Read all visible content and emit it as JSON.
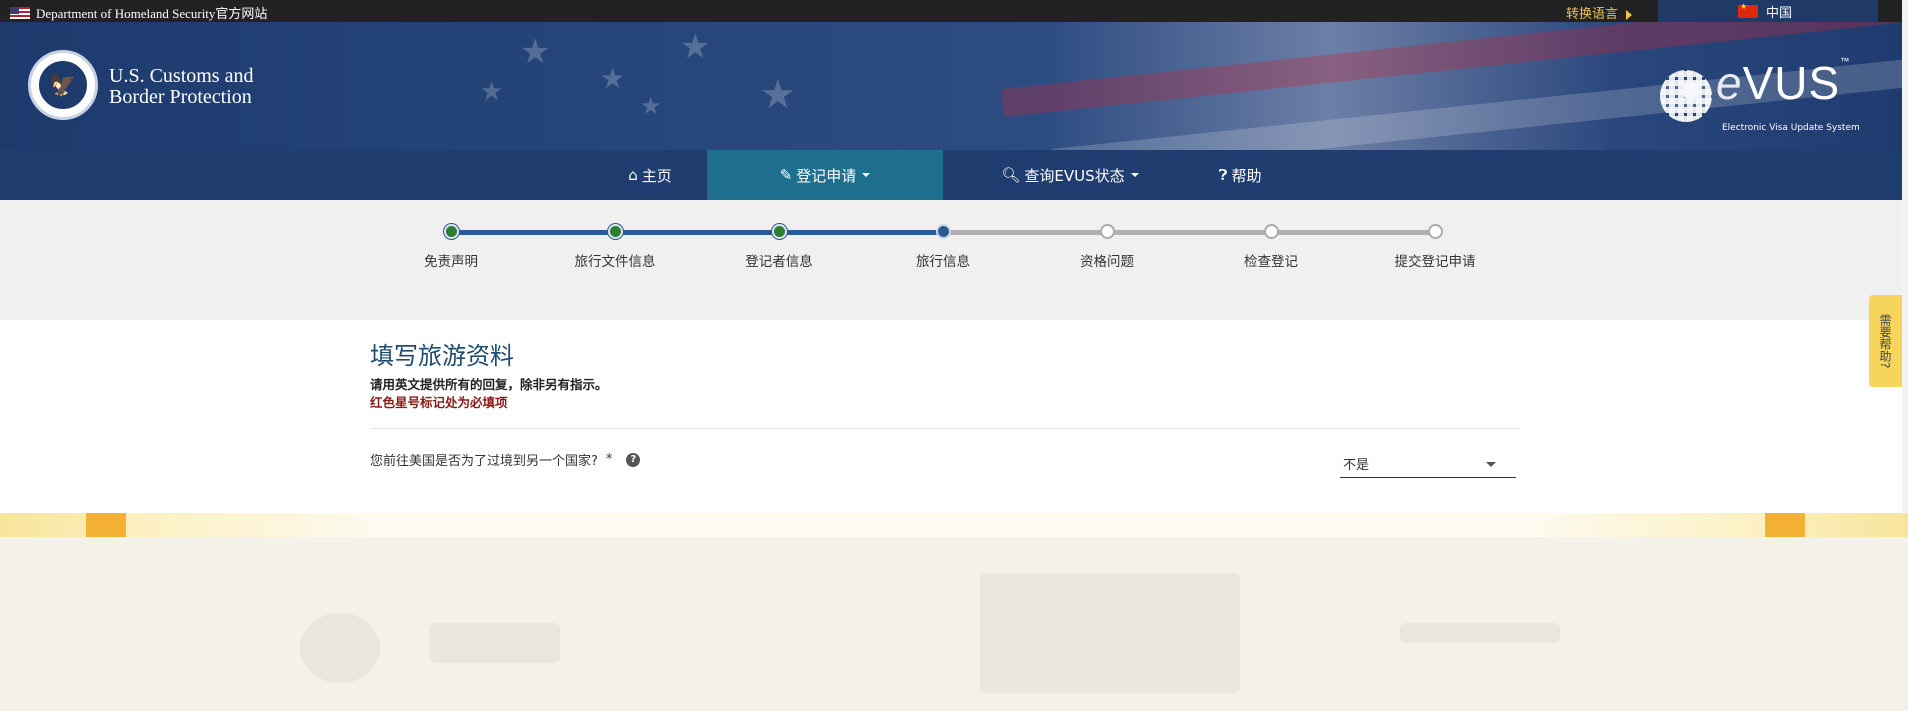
{
  "topbar": {
    "dhs_link": "Department of Homeland Security官方网站",
    "language_toggle": "转换语言",
    "country": "中国"
  },
  "header": {
    "agency_line1": "U.S. Customs and",
    "agency_line2": "Border Protection",
    "logo_text": "VUS",
    "logo_e": "e",
    "logo_tm": "™",
    "logo_subtitle": "Electronic Visa Update System"
  },
  "nav": {
    "items": [
      {
        "label": "主页",
        "icon": "home-icon"
      },
      {
        "label": "登记申请",
        "icon": "pencil-icon",
        "dropdown": true,
        "active": true
      },
      {
        "label": "查询EVUS状态",
        "icon": "search-icon",
        "dropdown": true
      },
      {
        "label": "帮助",
        "icon": "question-circle-icon"
      }
    ]
  },
  "progress": {
    "steps": [
      {
        "label": "免责声明",
        "status": "done"
      },
      {
        "label": "旅行文件信息",
        "status": "done"
      },
      {
        "label": "登记者信息",
        "status": "done"
      },
      {
        "label": "旅行信息",
        "status": "current"
      },
      {
        "label": "资格问题",
        "status": "todo"
      },
      {
        "label": "检查登记",
        "status": "todo"
      },
      {
        "label": "提交登记申请",
        "status": "todo"
      }
    ]
  },
  "form": {
    "title": "填写旅游资料",
    "instruction": "请用英文提供所有的回复，除非另有指示。",
    "required_note": "红色星号标记处为必填项",
    "question": "您前往美国是否为了过境到另一个国家?",
    "required_marker": "*",
    "answer": "不是"
  },
  "help_tab": {
    "label": "需要帮助?"
  },
  "colors": {
    "nav_bg": "#1f3d6e",
    "nav_active": "#1e6f8e",
    "step_done": "#2a5a96",
    "title": "#1e4b6e",
    "required": "#8b1a1a",
    "help_tab": "#f7d55c"
  }
}
